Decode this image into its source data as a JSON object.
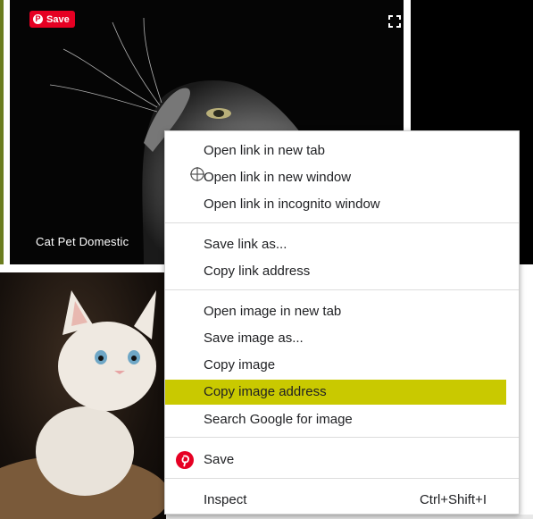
{
  "tiles": {
    "main": {
      "save_label": "Save",
      "tags": "Cat  Pet  Domestic"
    }
  },
  "icons": {
    "pinterest": "pinterest-icon",
    "expand": "expand-icon",
    "cursor": "move-cursor-icon"
  },
  "colors": {
    "pinterest_red": "#e60023",
    "highlight": "#c9c900"
  },
  "context_menu": {
    "items": [
      {
        "label": "Open link in new tab"
      },
      {
        "label": "Open link in new window"
      },
      {
        "label": "Open link in incognito window"
      },
      {
        "label": "Save link as..."
      },
      {
        "label": "Copy link address"
      },
      {
        "label": "Open image in new tab"
      },
      {
        "label": "Save image as..."
      },
      {
        "label": "Copy image"
      },
      {
        "label": "Copy image address"
      },
      {
        "label": "Search Google for image"
      },
      {
        "label": "Save"
      },
      {
        "label": "Inspect",
        "shortcut": "Ctrl+Shift+I"
      }
    ]
  }
}
